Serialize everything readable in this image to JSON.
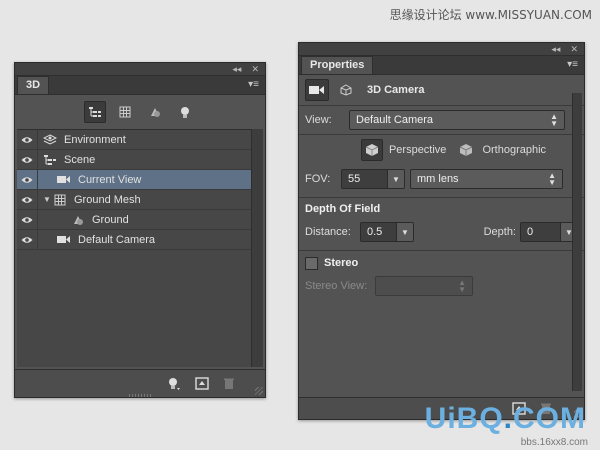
{
  "site": {
    "title": "思缘设计论坛 www.MISSYUAN.COM",
    "logo_main": "UiBQ",
    "logo_dot": ".",
    "logo_end": "COM",
    "url_text": "bbs.16xx8.com"
  },
  "panel3d": {
    "tab_label": "3D",
    "collapse_glyph": "◂◂",
    "close_glyph": "✕",
    "menu_glyph": "▾≡",
    "filters": [
      {
        "name": "scene-filter-icon",
        "active": true
      },
      {
        "name": "mesh-filter-icon",
        "active": false
      },
      {
        "name": "material-filter-icon",
        "active": false
      },
      {
        "name": "light-filter-icon",
        "active": false
      }
    ],
    "layers": [
      {
        "label": "Environment",
        "icon": "environment-icon",
        "visible": true,
        "indent": 0,
        "selected": false,
        "expander": ""
      },
      {
        "label": "Scene",
        "icon": "scene-icon",
        "visible": true,
        "indent": 0,
        "selected": false,
        "expander": ""
      },
      {
        "label": "Current View",
        "icon": "camera-icon",
        "visible": true,
        "indent": 1,
        "selected": true,
        "expander": ""
      },
      {
        "label": "Ground Mesh",
        "icon": "mesh-icon",
        "visible": true,
        "indent": 0,
        "selected": false,
        "expander": "▼"
      },
      {
        "label": "Ground",
        "icon": "material-icon",
        "visible": true,
        "indent": 2,
        "selected": false,
        "expander": ""
      },
      {
        "label": "Default Camera",
        "icon": "camera-icon",
        "visible": true,
        "indent": 1,
        "selected": false,
        "expander": ""
      }
    ]
  },
  "properties": {
    "tab_label": "Properties",
    "collapse_glyph": "◂◂",
    "close_glyph": "✕",
    "menu_glyph": "▾≡",
    "header_title": "3D Camera",
    "view_label": "View:",
    "view_value": "Default Camera",
    "perspective_label": "Perspective",
    "orthographic_label": "Orthographic",
    "fov_label": "FOV:",
    "fov_value": "55",
    "lens_value": "mm lens",
    "dof_title": "Depth Of Field",
    "distance_label": "Distance:",
    "distance_value": "0.5",
    "depth_label": "Depth:",
    "depth_value": "0",
    "stereo_label": "Stereo",
    "stereo_view_label": "Stereo View:",
    "stereo_view_value": ""
  },
  "colors": {
    "panel_bg": "#535353",
    "selected_row": "#5f7186",
    "page_bg": "#e6e6e6"
  }
}
